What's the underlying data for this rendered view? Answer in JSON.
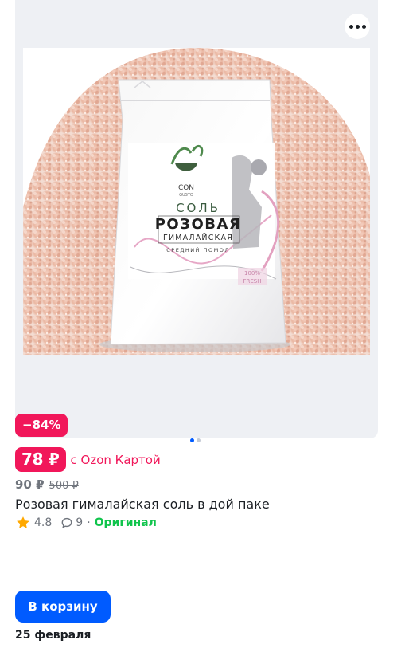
{
  "product": {
    "discount_badge": "−84%",
    "card_price": "78 ₽",
    "card_price_note": "с Ozon Картой",
    "regular_price": "90 ₽",
    "original_price": "500 ₽",
    "title": "Розовая гималайская соль в дой паке",
    "rating": "4.8",
    "reviews_count": "9",
    "separator": "·",
    "original_label": "Оригинал",
    "add_to_cart_label": "В корзину",
    "delivery_date": "25 февраля"
  },
  "package": {
    "brand": "CON",
    "brand_sub": "GUSTO",
    "line1": "СОЛЬ",
    "line2": "РОЗОВАЯ",
    "line3": "ГИМАЛАЙСКАЯ",
    "line4": "СРЕДНИЙ ПОМОЛ",
    "fresh_top": "100%",
    "fresh_bottom": "FRESH"
  },
  "gallery": {
    "pages_total": 2,
    "active_page": 1
  },
  "colors": {
    "accent_pink": "#f1175a",
    "primary_blue": "#005bff",
    "original_green": "#10c44c",
    "card_bg": "#eef0f4"
  },
  "icons": [
    "more-dots-icon",
    "star-icon",
    "comment-icon"
  ]
}
